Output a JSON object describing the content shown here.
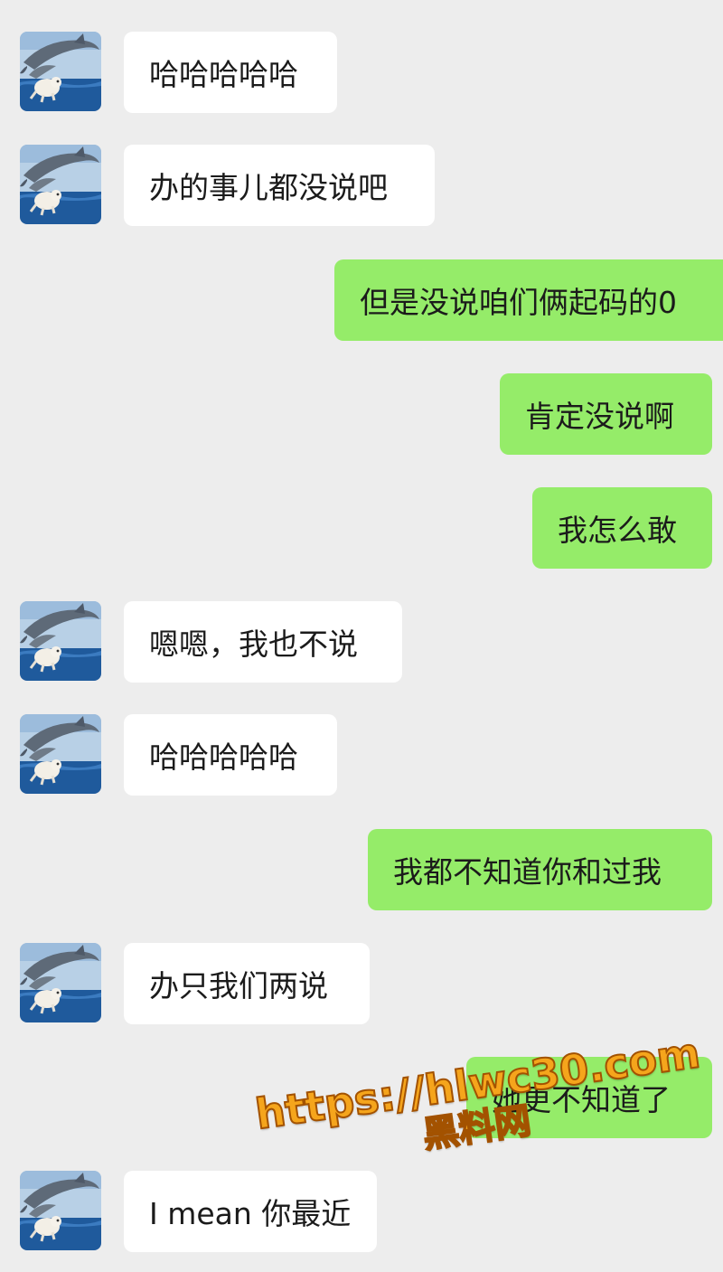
{
  "conversation": {
    "messages": [
      {
        "side": "incoming",
        "text": "哈哈哈哈哈"
      },
      {
        "side": "incoming",
        "text": "办的事儿都没说吧"
      },
      {
        "side": "outgoing",
        "text": "但是没说咱们俩起码的0"
      },
      {
        "side": "outgoing",
        "text": "肯定没说啊"
      },
      {
        "side": "outgoing",
        "text": "我怎么敢"
      },
      {
        "side": "incoming",
        "text": "嗯嗯，我也不说"
      },
      {
        "side": "incoming",
        "text": "哈哈哈哈哈"
      },
      {
        "side": "outgoing",
        "text": "我都不知道你和过我"
      },
      {
        "side": "incoming",
        "text": "办只我们两说"
      },
      {
        "side": "outgoing",
        "text": "她更不知道了"
      },
      {
        "side": "incoming",
        "text": "I mean 你最近"
      }
    ]
  },
  "avatar": {
    "icon": "dolphin-avatar-icon",
    "description": "dolphins leaping over ocean"
  },
  "watermark": {
    "url": "https://hlwc30.com",
    "name": "黑料网"
  },
  "colors": {
    "background": "#ededed",
    "incoming_bubble": "#ffffff",
    "outgoing_bubble": "#95ec69",
    "watermark_fill": "#f5a51c",
    "watermark_stroke": "#a35200"
  }
}
